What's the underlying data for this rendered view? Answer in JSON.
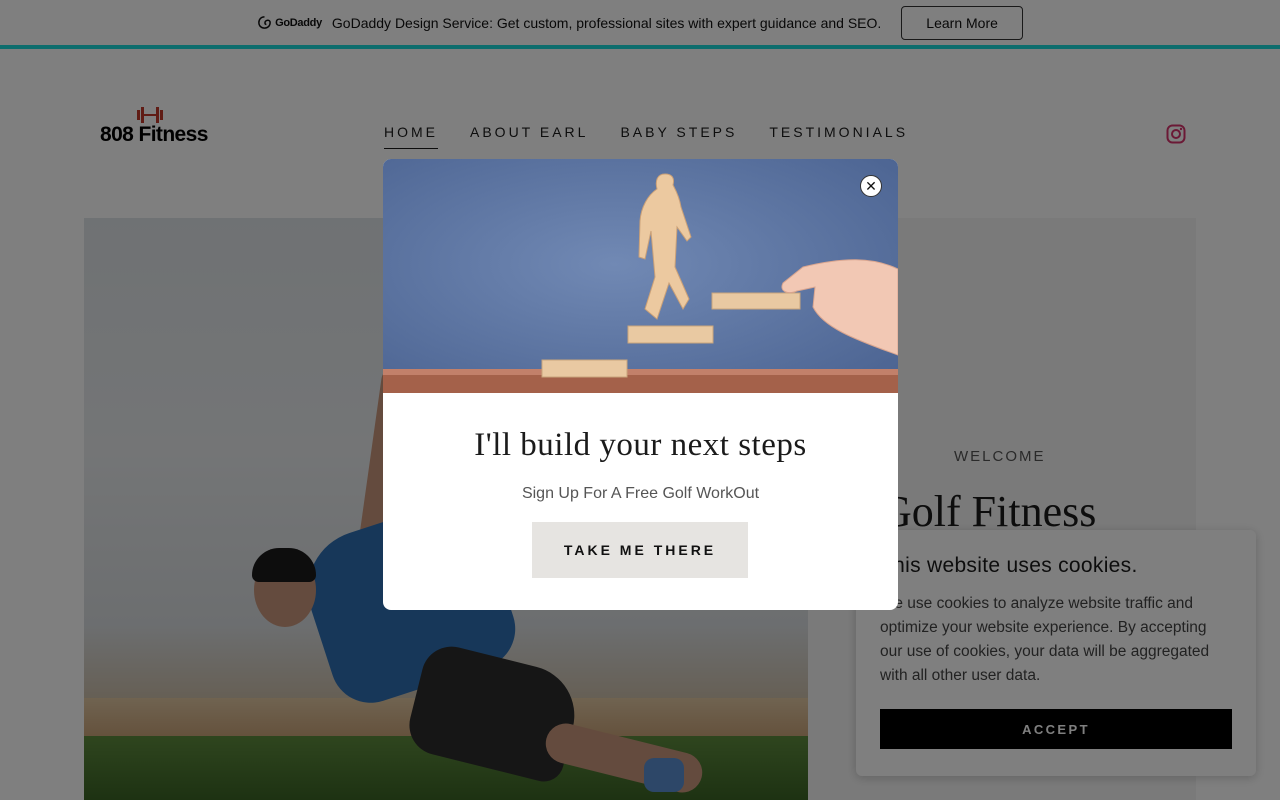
{
  "promo": {
    "brand": "GoDaddy",
    "text": "GoDaddy Design Service: Get custom, professional sites with expert guidance and SEO.",
    "button_label": "Learn More"
  },
  "header": {
    "logo_text": "808 Fitness",
    "nav": [
      {
        "label": "HOME",
        "active": true
      },
      {
        "label": "ABOUT EARL"
      },
      {
        "label": "BABY STEPS"
      },
      {
        "label": "TESTIMONIALS"
      }
    ],
    "instagram_color": "#d6336c"
  },
  "panel": {
    "eyebrow": "WELCOME",
    "title": "Golf Fitness"
  },
  "cookie": {
    "title": "This website uses cookies.",
    "body": "We use cookies to analyze website traffic and optimize your website experience. By accepting our use of cookies, your data will be aggregated with all other user data.",
    "accept_label": "ACCEPT"
  },
  "modal": {
    "title": "I'll build your next steps",
    "subtitle": "Sign Up For A Free Golf WorkOut",
    "button_label": "TAKE ME THERE",
    "close_label": "✕"
  },
  "colors": {
    "accent_bar": "#1bdbdb",
    "logo_red": "#c0392b"
  }
}
